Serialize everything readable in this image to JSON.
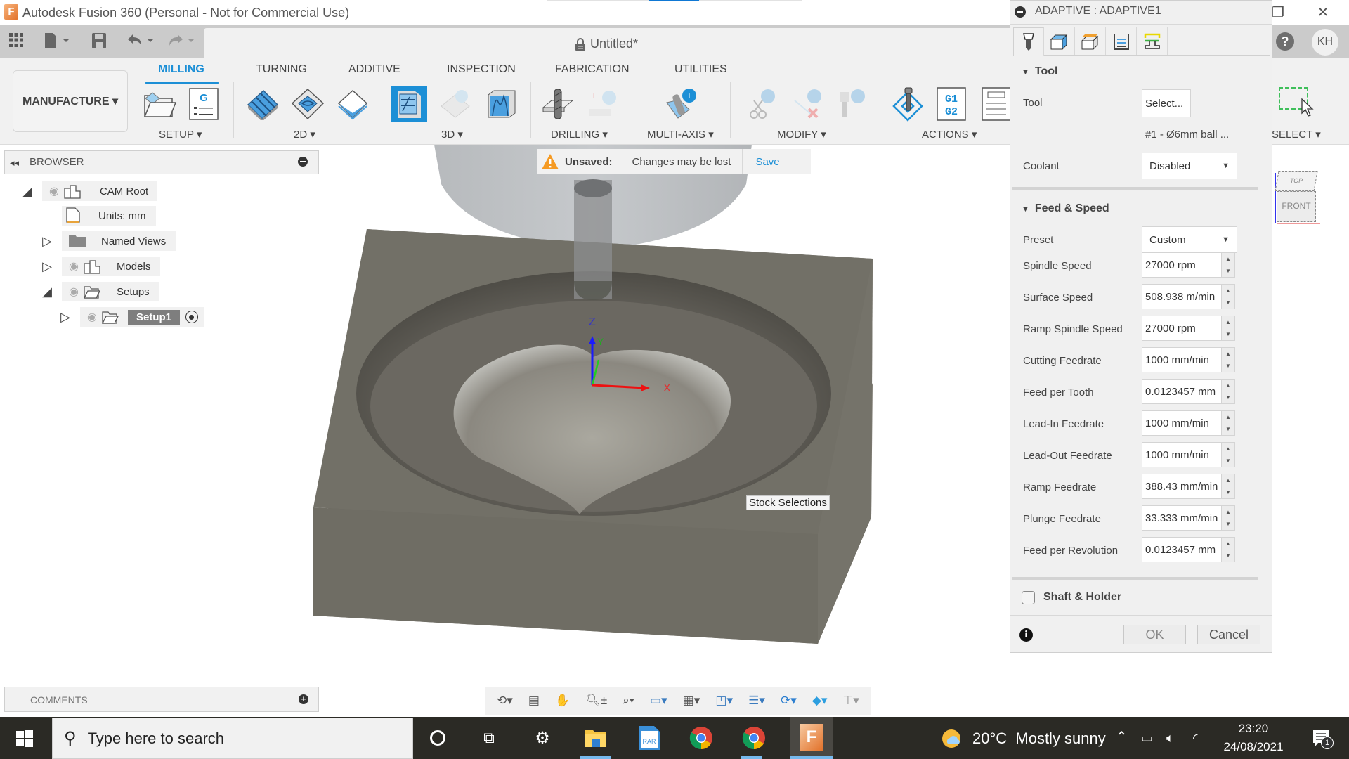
{
  "window": {
    "title": "Autodesk Fusion 360 (Personal - Not for Commercial Use)",
    "logo_letter": "F",
    "controls": {
      "restore": "❐",
      "close": "✕"
    }
  },
  "quick_access": {
    "grid_icon": "app-grid-icon",
    "file_icon": "file-icon",
    "save_icon": "save-icon",
    "undo_icon": "undo-icon",
    "redo_icon": "redo-icon",
    "document_title": "Untitled*"
  },
  "ribbon": {
    "workspace": "MANUFACTURE ▾",
    "tabs": [
      {
        "label": "MILLING",
        "active": true
      },
      {
        "label": "TURNING",
        "active": false
      },
      {
        "label": "ADDITIVE",
        "active": false
      },
      {
        "label": "INSPECTION",
        "active": false
      },
      {
        "label": "FABRICATION",
        "active": false
      },
      {
        "label": "UTILITIES",
        "active": false
      }
    ],
    "groups": [
      {
        "label": "SETUP ▾"
      },
      {
        "label": "2D ▾"
      },
      {
        "label": "3D ▾"
      },
      {
        "label": "DRILLING ▾"
      },
      {
        "label": "MULTI-AXIS ▾"
      },
      {
        "label": "MODIFY ▾"
      },
      {
        "label": "ACTIONS ▾"
      },
      {
        "label": "SELECT ▾"
      }
    ],
    "actions_gcode_label": "G1\nG2",
    "setup_sheet_letter": "G"
  },
  "user": {
    "initials": "KH",
    "help": "?"
  },
  "browser": {
    "title": "BROWSER",
    "items": [
      {
        "label": "CAM Root",
        "expanded": true
      },
      {
        "label": "Units: mm"
      },
      {
        "label": "Named Views",
        "expanded": false
      },
      {
        "label": "Models",
        "expanded": false
      },
      {
        "label": "Setups",
        "expanded": true
      },
      {
        "label": "Setup1",
        "expanded": false,
        "selected": true
      }
    ]
  },
  "unsaved_banner": {
    "label": "Unsaved:",
    "message": "Changes may be lost",
    "action": "Save"
  },
  "viewport": {
    "tooltip": "Stock Selections",
    "axes": {
      "x": "X",
      "y": "Y",
      "z": "Z"
    },
    "viewcube": {
      "top": "TOP",
      "front": "FRONT"
    }
  },
  "panel": {
    "title": "ADAPTIVE : ADAPTIVE1",
    "tabs": [
      "tool-tab",
      "geometry-tab",
      "heights-tab",
      "passes-tab",
      "linking-tab"
    ],
    "tool_section": {
      "title": "Tool",
      "tool_label": "Tool",
      "tool_button": "Select...",
      "tool_name": "#1 - Ø6mm ball ...",
      "coolant_label": "Coolant",
      "coolant_value": "Disabled"
    },
    "feed_section": {
      "title": "Feed & Speed",
      "preset_label": "Preset",
      "preset_value": "Custom",
      "fields": [
        {
          "label": "Spindle Speed",
          "value": "27000 rpm"
        },
        {
          "label": "Surface Speed",
          "value": "508.938 m/min"
        },
        {
          "label": "Ramp Spindle Speed",
          "value": "27000 rpm"
        },
        {
          "label": "Cutting Feedrate",
          "value": "1000 mm/min"
        },
        {
          "label": "Feed per Tooth",
          "value": "0.0123457 mm"
        },
        {
          "label": "Lead-In Feedrate",
          "value": "1000 mm/min"
        },
        {
          "label": "Lead-Out Feedrate",
          "value": "1000 mm/min"
        },
        {
          "label": "Ramp Feedrate",
          "value": "388.43 mm/min"
        },
        {
          "label": "Plunge Feedrate",
          "value": "33.333 mm/min"
        },
        {
          "label": "Feed per Revolution",
          "value": "0.0123457 mm"
        }
      ]
    },
    "shaft_holder": {
      "label": "Shaft & Holder",
      "checked": false
    },
    "ok": "OK",
    "cancel": "Cancel"
  },
  "comments": {
    "title": "COMMENTS"
  },
  "taskbar": {
    "search_placeholder": "Type here to search",
    "weather": "20°C  Mostly sunny",
    "time": "23:20",
    "date": "24/08/2021",
    "notifications": "1"
  }
}
